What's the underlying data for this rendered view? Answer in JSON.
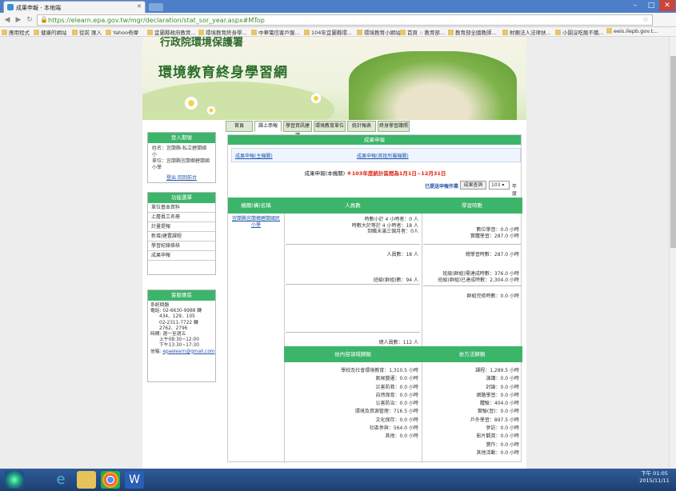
{
  "browser": {
    "tab_title": "成果申報 - 本地端",
    "url": "https://elearn.epa.gov.tw/mgr/declaration/stat_sor_year.aspx#MTop",
    "bookmarks": [
      "應用程式",
      "健康的網站",
      "從前 匯入",
      "Yahoo奇摩",
      "宜蘭縣政府教育...",
      "環境教育終身學...",
      "中華電信客戶服...",
      "104年宜蘭縣環...",
      "環境教育小網站",
      "首頁 :: 教育部...",
      "教育部全國教師...",
      "財團法人法律扶...",
      "小園沒吃飯不餓...",
      "eeis.ilepb.gov.t..."
    ]
  },
  "site": {
    "agency": "行政院環境保護署",
    "name": "環境教育終身學習網",
    "nav_tabs": [
      "首頁",
      "課上串報",
      "學習資訊建議",
      "環境教育單位",
      "統計報表",
      "終身學習護照"
    ]
  },
  "login": {
    "heading": "登入期號",
    "lines": [
      "姓名：宜蘭縣-私立碧蘭國小",
      "單位：宜蘭縣宜蘭鄉碧蘭國",
      "小學"
    ],
    "links": "登出 回到前台"
  },
  "functions": {
    "heading": "功能選單",
    "items": [
      "單位基本資料",
      "上層員工名冊",
      "計畫提報",
      "新增/建置課程",
      "學習紀錄條核",
      "成果申報"
    ]
  },
  "service": {
    "heading": "客服專區",
    "text": "系統問題\n電話: 02-6630-9988 轉\n      434、129、105\n      02-2311-7722 轉\n      2762、2796\n時間: 週一至週五\n      上午08:30~12:00\n      下午13:30~17:30\n信箱: ",
    "email": "epaelearn@gmail.com"
  },
  "main": {
    "heading": "成果申報",
    "sublink_left": "成果申報(主機關)",
    "sublink_right": "成果申報(首批所屬機關)",
    "title_prefix": "成果申報(本機關)",
    "title_note": "＊103年度統計區間為1月1日~12月31日",
    "submitted_label": "已提送申報作業",
    "query_button": "成果查詢",
    "year_value": "103",
    "year_suffix": "年度",
    "col_org": "機關(構)名稱",
    "col_people": "人員數",
    "col_hours": "學習時數",
    "org_name": "宜蘭縣宜蘭鄉碧蘭國民小學",
    "people_block1": [
      "時數小於 4 小時者：0 人",
      "時數大於等於 4 小時者：18 人",
      "到職未滿三個月者：0人"
    ],
    "people_total": "人員數：18 人",
    "people_class": "班級(群組)數：94 人",
    "people_all": "總人員數：112 人",
    "hours_block1": [
      "數位學習：0.0 小時",
      "實體學習：287.0 小時"
    ],
    "hours_total": "總學習時數：287.0 小時",
    "hours_class": [
      "班級(群組)需達成時數：376.0 小時",
      "班級(群組)已達成時數：2,304.0 小時"
    ],
    "hours_group": "群組完修時數：0.0 小時",
    "sec_domains": "依內容領域歸類",
    "sec_methods": "依方法歸類",
    "domains": [
      "學校及社會環境教育：1,310.5 小時",
      "氣候變遷：0.0 小時",
      "災害防救：0.0 小時",
      "自然保育：0.0 小時",
      "公害防治：0.0 小時",
      "環境及資源管理：716.5 小時",
      "文化保存：0.0 小時",
      "社區參與：564.0 小時",
      "其他：0.0 小時"
    ],
    "methods": [
      "課程：1,289.5 小時",
      "演講：0.0 小時",
      "討論：0.0 小時",
      "網路學習：0.0 小時",
      "體驗：404.0 小時",
      "實驗(習)：0.0 小時",
      "戶外學習：897.5 小時",
      "參訪：0.0 小時",
      "影片觀賞：0.0 小時",
      "實作：0.0 小時",
      "其他活動：0.0 小時"
    ]
  },
  "clock": {
    "time": "下午 01:05",
    "date": "2015/11/11"
  }
}
